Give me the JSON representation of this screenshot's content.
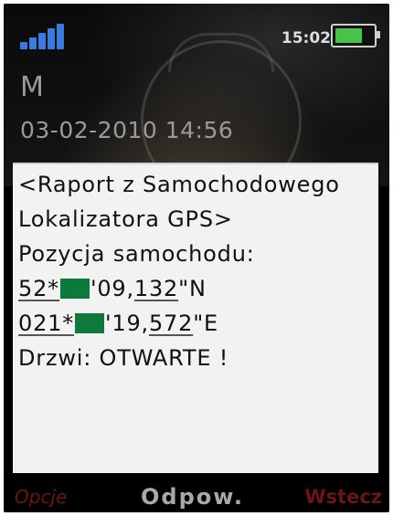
{
  "status_bar": {
    "time": "15:02",
    "signal_bars": 5,
    "battery_level": 0.75,
    "signal_color": "#3a7be0",
    "battery_color": "#49c34a"
  },
  "idle": {
    "network": "M",
    "datetime": "03-02-2010 14:56"
  },
  "message": {
    "header_line1": "<Raport z Samochodowego",
    "header_line2": "Lokalizatora GPS>",
    "position_label": "Pozycja samochodu:",
    "lat_deg": "52*",
    "lat_rest": "'09,",
    "lat_sec": "132",
    "lat_hemi": "\"N",
    "lon_deg": "021*",
    "lon_rest": "'19,",
    "lon_sec": "572",
    "lon_hemi": "\"E",
    "door_status": "Drzwi: OTWARTE !",
    "redaction_color": "#0d7a3c"
  },
  "softkeys": {
    "left": "Opcje",
    "center": "Odpow.",
    "right": "Wstecz"
  }
}
